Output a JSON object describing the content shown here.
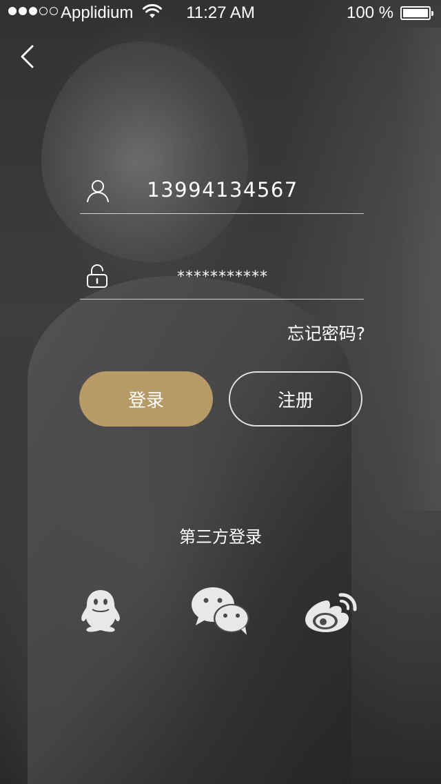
{
  "status_bar": {
    "carrier": "Applidium",
    "time": "11:27 AM",
    "battery": "100 %",
    "battery_level": 1.0
  },
  "login_form": {
    "username_value": "13994134567",
    "password_value": "***********",
    "forgot_label": "忘记密码?",
    "login_label": "登录",
    "register_label": "注册"
  },
  "third_party": {
    "title": "第三方登录",
    "providers": [
      "qq-icon",
      "wechat-icon",
      "weibo-icon"
    ]
  },
  "icons": {
    "back": "chevron-left-icon",
    "user": "user-icon",
    "password": "unlock-icon"
  },
  "colors": {
    "accent": "#b89a66",
    "text": "#ffffff"
  }
}
